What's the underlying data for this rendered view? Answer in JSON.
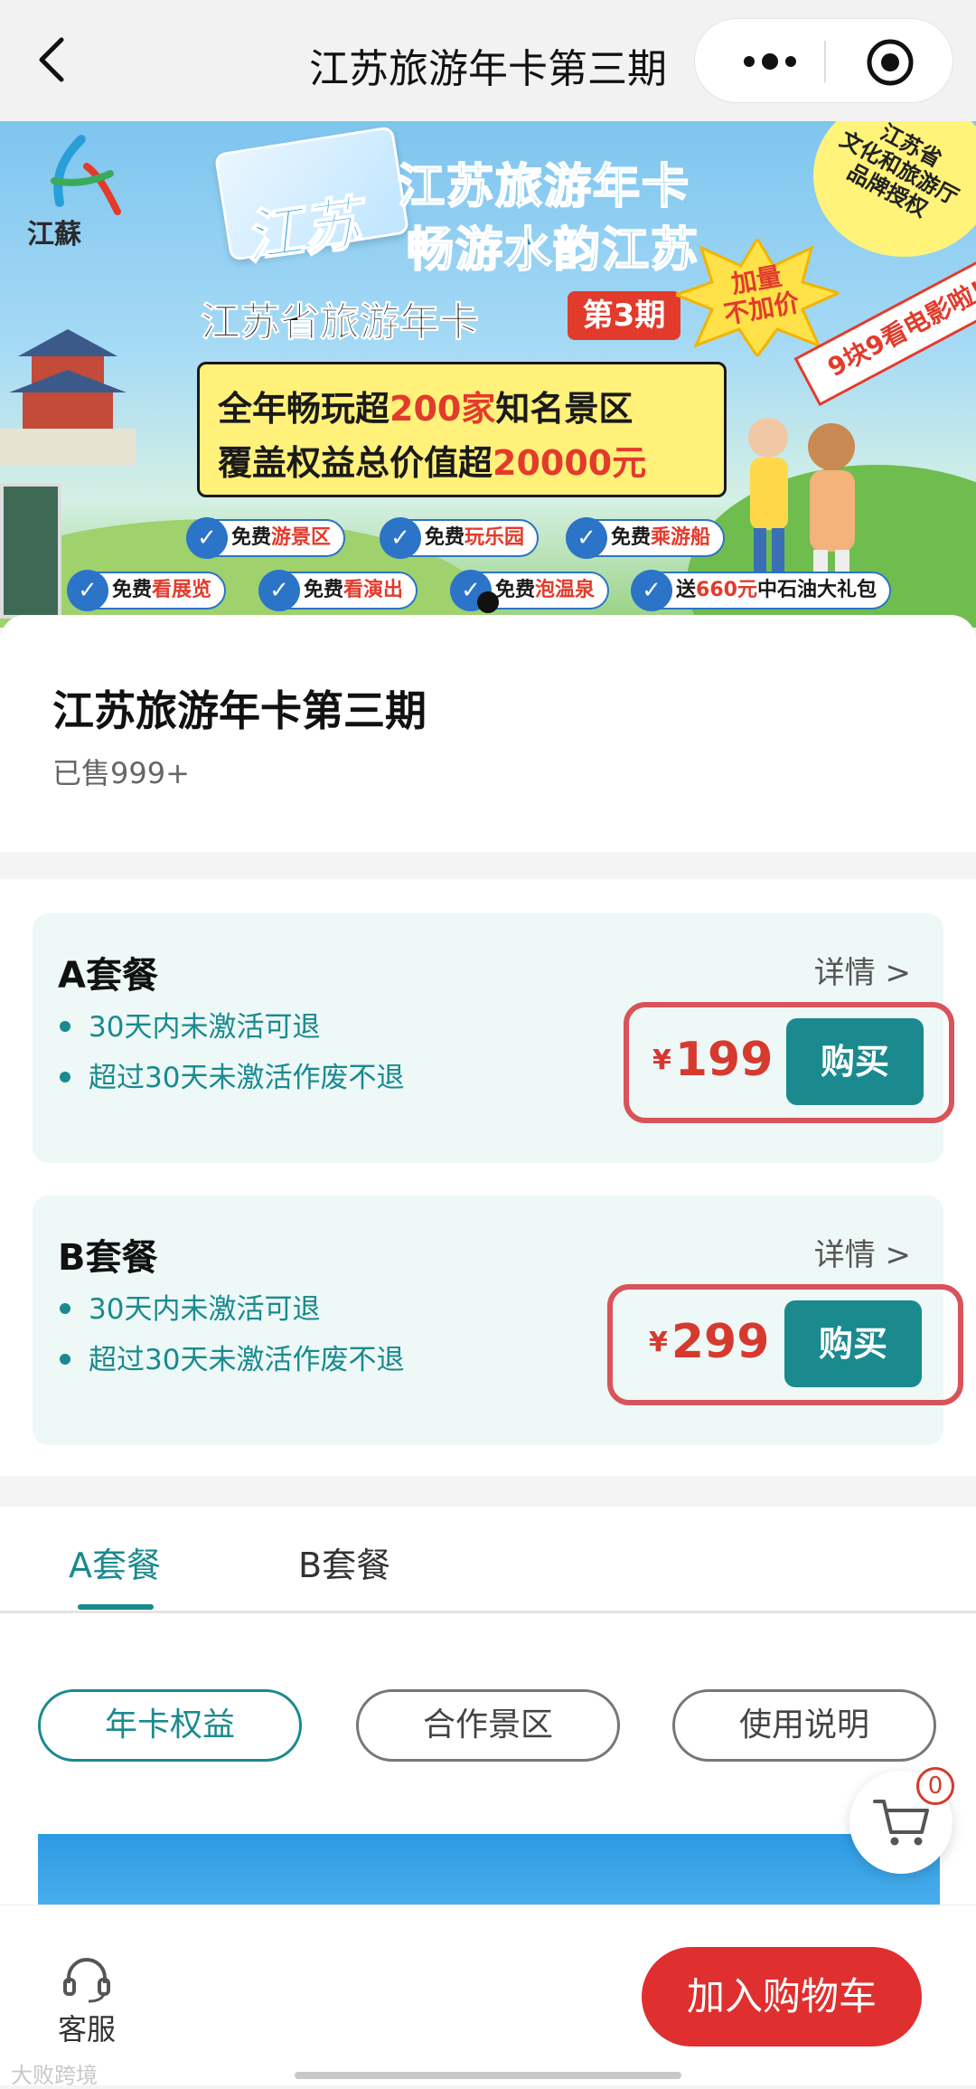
{
  "navbar": {
    "title": "江苏旅游年卡第三期"
  },
  "banner": {
    "script_title": "江苏",
    "title_line1": "江苏旅游年卡",
    "title_line2": "畅游水韵江苏",
    "main_title": "江苏省旅游年卡",
    "issue_badge": "第3期",
    "starburst": "加量\n不加价",
    "box_line1_pre": "全年畅玩超",
    "box_line1_num": "200家",
    "box_line1_post": "知名景区",
    "box_line2_pre": "覆盖权益总价值超",
    "box_line2_num": "20000元",
    "ribbon": "9块9看电影啦!",
    "corner_badge": "江苏省\n文化和旅游厅\n品牌授权",
    "logo_text": "江蘇",
    "chips": [
      {
        "pre": "免费",
        "em": "游景区"
      },
      {
        "pre": "免费",
        "em": "玩乐园"
      },
      {
        "pre": "免费",
        "em": "乘游船"
      },
      {
        "pre": "免费",
        "em": "看展览"
      },
      {
        "pre": "免费",
        "em": "看演出"
      },
      {
        "pre": "免费",
        "em": "泡温泉"
      },
      {
        "pre": "送",
        "em": "660元",
        "post": "中石油大礼包"
      }
    ]
  },
  "product": {
    "title": "江苏旅游年卡第三期",
    "sold": "已售999+"
  },
  "packages": [
    {
      "name": "A套餐",
      "detail": "详情 >",
      "bullets": [
        "30天内未激活可退",
        "超过30天未激活作废不退"
      ],
      "currency": "¥",
      "price": "199",
      "buy": "购买"
    },
    {
      "name": "B套餐",
      "detail": "详情 >",
      "bullets": [
        "30天内未激活可退",
        "超过30天未激活作废不退"
      ],
      "currency": "¥",
      "price": "299",
      "buy": "购买"
    }
  ],
  "tabs": [
    {
      "label": "A套餐",
      "active": true
    },
    {
      "label": "B套餐",
      "active": false
    }
  ],
  "pills": [
    {
      "label": "年卡权益",
      "active": true
    },
    {
      "label": "合作景区",
      "active": false
    },
    {
      "label": "使用说明",
      "active": false
    }
  ],
  "cart": {
    "count": "0",
    "icon": "cart-icon"
  },
  "bottombar": {
    "service_label": "客服",
    "service_icon": "headset-icon",
    "add_to_cart": "加入购物车",
    "watermark": "大败跨境"
  },
  "colors": {
    "accent": "#1a8a8e",
    "price": "#d63a2f",
    "cart_button": "#e02f2f",
    "package_bg": "#edf8f7",
    "highlight_border": "#d9535a"
  }
}
